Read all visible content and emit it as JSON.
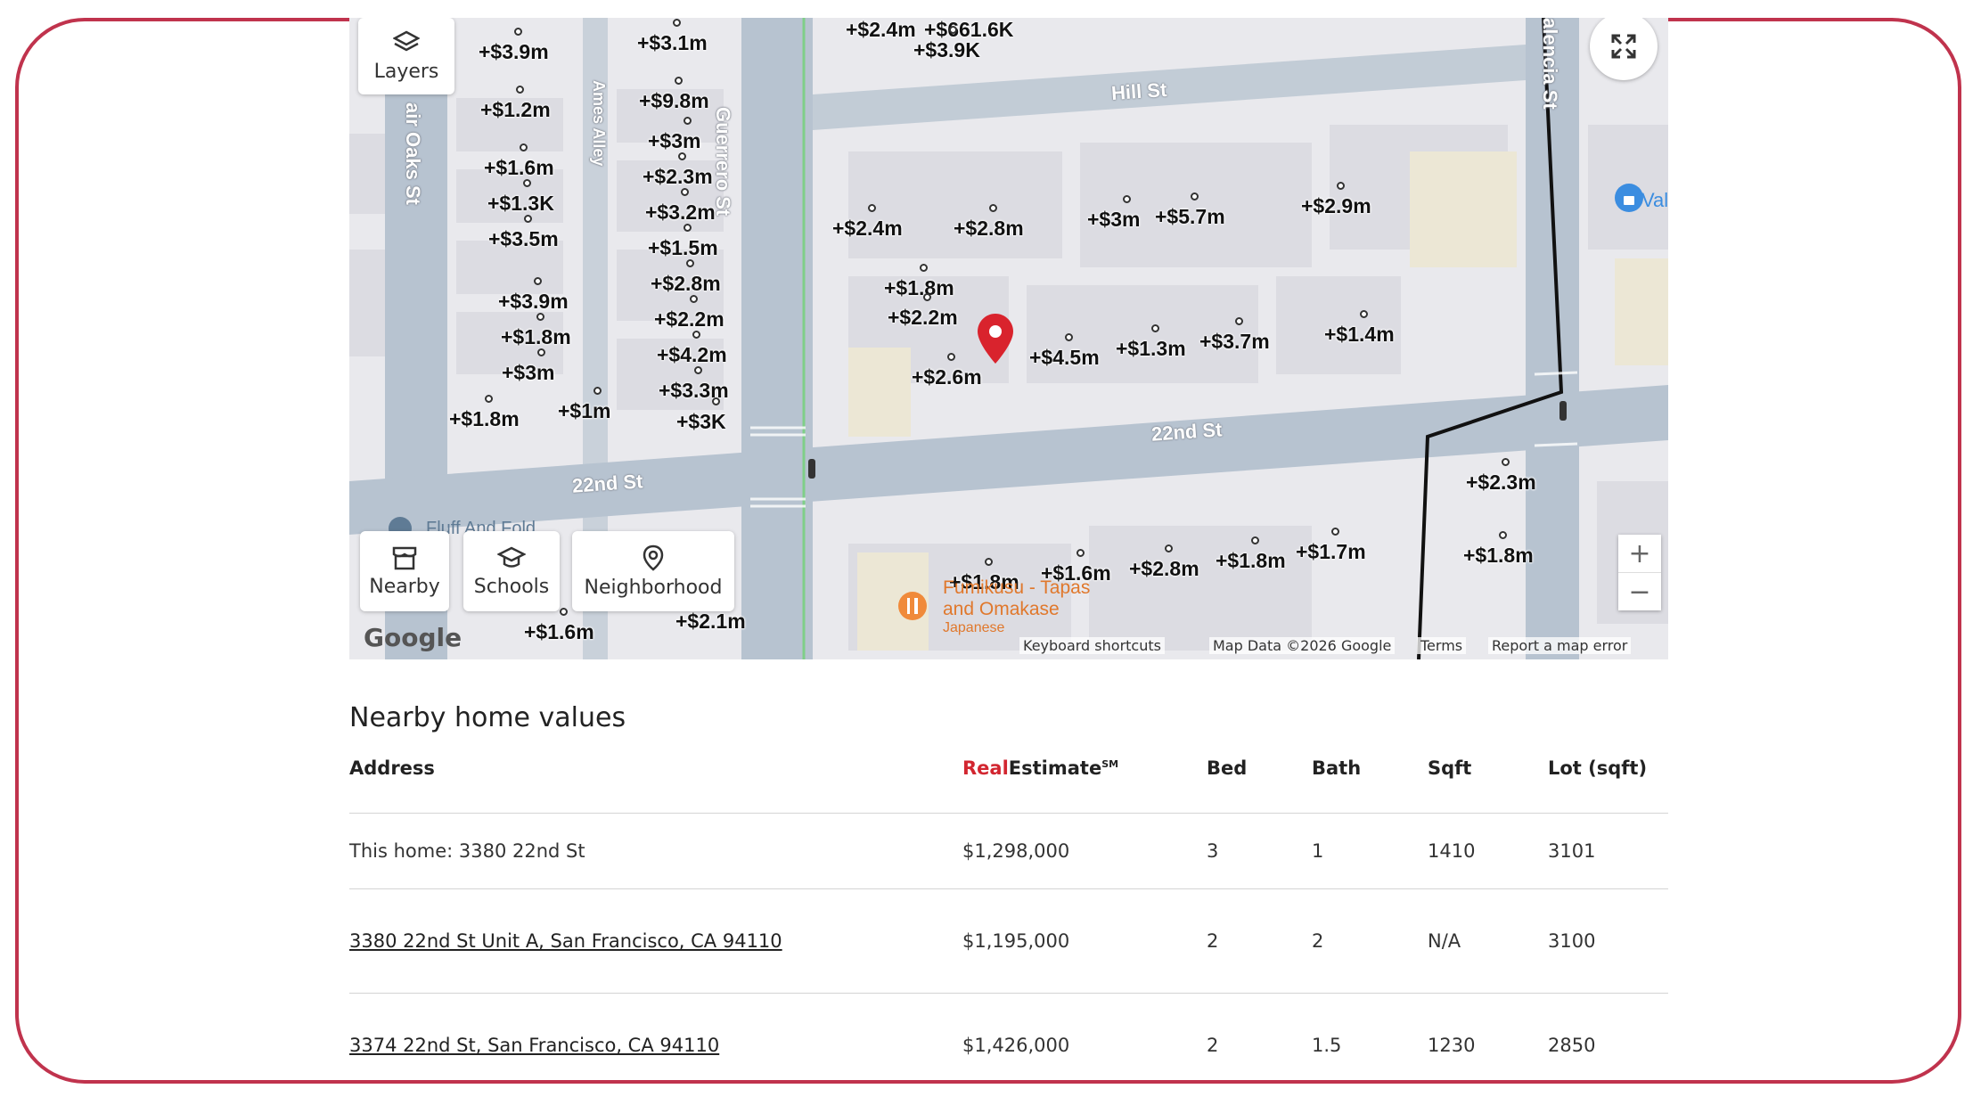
{
  "map": {
    "controls": {
      "layers_label": "Layers",
      "nearby_label": "Nearby",
      "schools_label": "Schools",
      "neighborhood_label": "Neighborhood",
      "zoom_in": "+",
      "zoom_out": "−"
    },
    "streets": {
      "hill": "Hill St",
      "guerrero": "Guerrero St",
      "ames": "Ames Alley",
      "fair_oaks": "air Oaks St",
      "valencia": "alencia St",
      "st22_left": "22nd St",
      "st22_right": "22nd St"
    },
    "places": {
      "restaurant_name": "Fumikusu - Tapas and Omakase",
      "restaurant_type": "Japanese",
      "fluff": "Fluff And Fold",
      "val": "Val"
    },
    "price_labels": [
      "+$3.9m",
      "+$3.1m",
      "+$2.4m",
      "+$661.6K",
      "+$3.9K",
      "+$1.2m",
      "+$9.8m",
      "+$1.6m",
      "+$3m",
      "+$2.3m",
      "+$1.3K",
      "+$3.2m",
      "+$3.5m",
      "+$1.5m",
      "+$2.8m",
      "+$3.9m",
      "+$2.2m",
      "+$1.8m",
      "+$4.2m",
      "+$3m",
      "+$3.3m",
      "+$1.8m",
      "+$1m",
      "+$3K",
      "+$2.4m",
      "+$2.8m",
      "+$3m",
      "+$5.7m",
      "+$2.9m",
      "+$1.8m",
      "+$2.2m",
      "+$4.5m",
      "+$1.3m",
      "+$3.7m",
      "+$1.4m",
      "+$2.6m",
      "+$1.8m",
      "+$2.3m",
      "+$1.8m",
      "+$1.6m",
      "+$2.8m",
      "+$1.8m",
      "+$1.7m",
      "+$1.6m",
      "+$2.1m"
    ],
    "attribution": {
      "logo": "Google",
      "keyboard": "Keyboard shortcuts",
      "map_data": "Map Data ©2026 Google",
      "terms": "Terms",
      "report": "Report a map error"
    }
  },
  "nearby": {
    "title": "Nearby home values",
    "columns": {
      "address": "Address",
      "realestimate_red": "Real",
      "realestimate_rest": "Estimate",
      "realestimate_mark": "SM",
      "bed": "Bed",
      "bath": "Bath",
      "sqft": "Sqft",
      "lot": "Lot (sqft)"
    },
    "rows": [
      {
        "address": "This home: 3380 22nd St",
        "estimate": "$1,298,000",
        "bed": "3",
        "bath": "1",
        "sqft": "1410",
        "lot": "3101"
      },
      {
        "address": "3380 22nd St Unit A, San Francisco, CA 94110",
        "estimate": "$1,195,000",
        "bed": "2",
        "bath": "2",
        "sqft": "N/A",
        "lot": "3100"
      },
      {
        "address": "3374 22nd St, San Francisco, CA 94110",
        "estimate": "$1,426,000",
        "bed": "2",
        "bath": "1.5",
        "sqft": "1230",
        "lot": "2850"
      }
    ]
  },
  "colors": {
    "frame": "#c0334d",
    "accent_red": "#d22630",
    "pin": "#d9232d"
  }
}
